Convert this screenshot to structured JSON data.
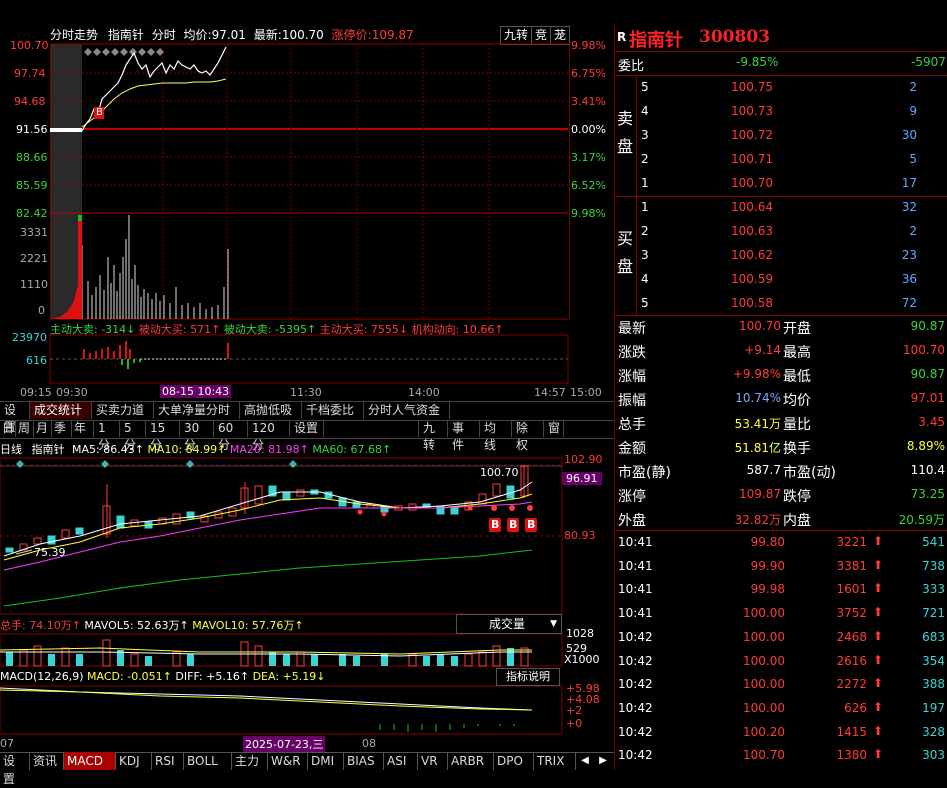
{
  "intraday": {
    "title_parts": [
      "分时走势",
      "指南针",
      "分时",
      "均价:",
      "97.01",
      "最新:",
      "100.70",
      "涨停价:",
      "109.87"
    ],
    "right_buttons": [
      "九转",
      "竞",
      "茏"
    ],
    "left_prices": [
      "100.70",
      "97.74",
      "94.68",
      "91.56",
      "88.66",
      "85.59",
      "82.42"
    ],
    "right_pcts": [
      "9.98%",
      "6.75%",
      "3.41%",
      "0.00%",
      "3.17%",
      "6.52%",
      "9.98%"
    ],
    "vol_labels": [
      "3331",
      "2221",
      "1110",
      "0"
    ],
    "indicator_line": [
      "主动大卖: -314↓",
      "被动大买: 571↑",
      "被动大卖: -5395↑",
      "主动大买: 7555↓",
      "机构动向: 10.66↑"
    ],
    "sub_labels": [
      "23970",
      "616"
    ],
    "time_axis": [
      "09:15",
      "09:30",
      "08-15 10:43",
      "11:30",
      "14:00",
      "14:57",
      "15:00"
    ],
    "b_marker": "B"
  },
  "mid_tabs": [
    "设置",
    "成交统计",
    "买卖力道",
    "大单净量分时",
    "高抛低吸",
    "千档委比",
    "分时人气资金"
  ],
  "kline": {
    "period_tabs": [
      "日",
      "周",
      "月",
      "季",
      "年",
      "1分",
      "5分",
      "15分",
      "30分",
      "60分",
      "120分",
      "设置"
    ],
    "right_tabs": [
      "九转",
      "事件",
      "均线",
      "除权",
      "窗"
    ],
    "ma_line": [
      "日线",
      "指南针",
      "MA5: 86.43↑",
      "MA10: 84.99↑",
      "MA20: 81.98↑",
      "MA60: 67.68↑"
    ],
    "price_labels": [
      "102.90",
      "96.91",
      "80.93"
    ],
    "high_label": "100.70",
    "low_label": "75.39",
    "b_marks": [
      "B",
      "B",
      "B"
    ],
    "vol_line": [
      "总手: 74.10万↑",
      "MAVOL5: 52.63万↑",
      "MAVOL10: 57.76万↑"
    ],
    "vol_dropdown": "成交量",
    "vol_labels": [
      "1028",
      "529",
      "X1000"
    ],
    "macd_line": [
      "MACD(12,26,9)",
      "MACD: -0.051↑",
      "DIFF: +5.16↑",
      "DEA: +5.19↓"
    ],
    "macd_btn": "指标说明",
    "macd_labels": [
      "+5.98",
      "+4.08",
      "+2",
      "+0"
    ],
    "date_axis": [
      "07",
      "2025-07-23,三",
      "08"
    ]
  },
  "bottom_tabs": [
    "设置",
    "资讯",
    "MACD",
    "KDJ",
    "RSI",
    "BOLL",
    "主力",
    "W&R",
    "DMI",
    "BIAS",
    "ASI",
    "VR",
    "ARBR",
    "DPO",
    "TRIX"
  ],
  "quote": {
    "r_badge": "R",
    "name": "指南针",
    "code": "300803",
    "webi_label": "委比",
    "webi_pct": "-9.85%",
    "webi_diff": "-5907",
    "sell_label": [
      "卖",
      "盘"
    ],
    "buy_label": [
      "买",
      "盘"
    ],
    "sell": [
      {
        "lvl": "5",
        "price": "100.75",
        "vol": "2"
      },
      {
        "lvl": "4",
        "price": "100.73",
        "vol": "9"
      },
      {
        "lvl": "3",
        "price": "100.72",
        "vol": "30"
      },
      {
        "lvl": "2",
        "price": "100.71",
        "vol": "5"
      },
      {
        "lvl": "1",
        "price": "100.70",
        "vol": "17"
      }
    ],
    "buy": [
      {
        "lvl": "1",
        "price": "100.64",
        "vol": "32"
      },
      {
        "lvl": "2",
        "price": "100.63",
        "vol": "2"
      },
      {
        "lvl": "3",
        "price": "100.62",
        "vol": "23"
      },
      {
        "lvl": "4",
        "price": "100.59",
        "vol": "36"
      },
      {
        "lvl": "5",
        "price": "100.58",
        "vol": "72"
      }
    ],
    "stats": [
      {
        "l": "最新",
        "v": "100.70",
        "l2": "开盘",
        "v2": "90.87"
      },
      {
        "l": "涨跌",
        "v": "+9.14",
        "l2": "最高",
        "v2": "100.70"
      },
      {
        "l": "涨幅",
        "v": "+9.98%",
        "l2": "最低",
        "v2": "90.87"
      },
      {
        "l": "振幅",
        "v": "10.74%",
        "l2": "均价",
        "v2": "97.01"
      },
      {
        "l": "总手",
        "v": "53.41万",
        "l2": "量比",
        "v2": "3.45"
      },
      {
        "l": "金额",
        "v": "51.81亿",
        "l2": "换手",
        "v2": "8.89%"
      },
      {
        "l": "市盈(静)",
        "v": "587.7",
        "l2": "市盈(动)",
        "v2": "110.4"
      },
      {
        "l": "涨停",
        "v": "109.87",
        "l2": "跌停",
        "v2": "73.25"
      },
      {
        "l": "外盘",
        "v": "32.82万",
        "l2": "内盘",
        "v2": "20.59万"
      }
    ],
    "ticks": [
      {
        "t": "10:41",
        "p": "99.80",
        "v": "3221",
        "n": "541"
      },
      {
        "t": "10:41",
        "p": "99.90",
        "v": "3381",
        "n": "738"
      },
      {
        "t": "10:41",
        "p": "99.98",
        "v": "1601",
        "n": "333"
      },
      {
        "t": "10:41",
        "p": "100.00",
        "v": "3752",
        "n": "721"
      },
      {
        "t": "10:42",
        "p": "100.00",
        "v": "2468",
        "n": "683"
      },
      {
        "t": "10:42",
        "p": "100.00",
        "v": "2616",
        "n": "354"
      },
      {
        "t": "10:42",
        "p": "100.00",
        "v": "2272",
        "n": "388"
      },
      {
        "t": "10:42",
        "p": "100.00",
        "v": "626",
        "n": "197"
      },
      {
        "t": "10:42",
        "p": "100.20",
        "v": "1415",
        "n": "328"
      },
      {
        "t": "10:42",
        "p": "100.70",
        "v": "1380",
        "n": "303"
      }
    ]
  }
}
